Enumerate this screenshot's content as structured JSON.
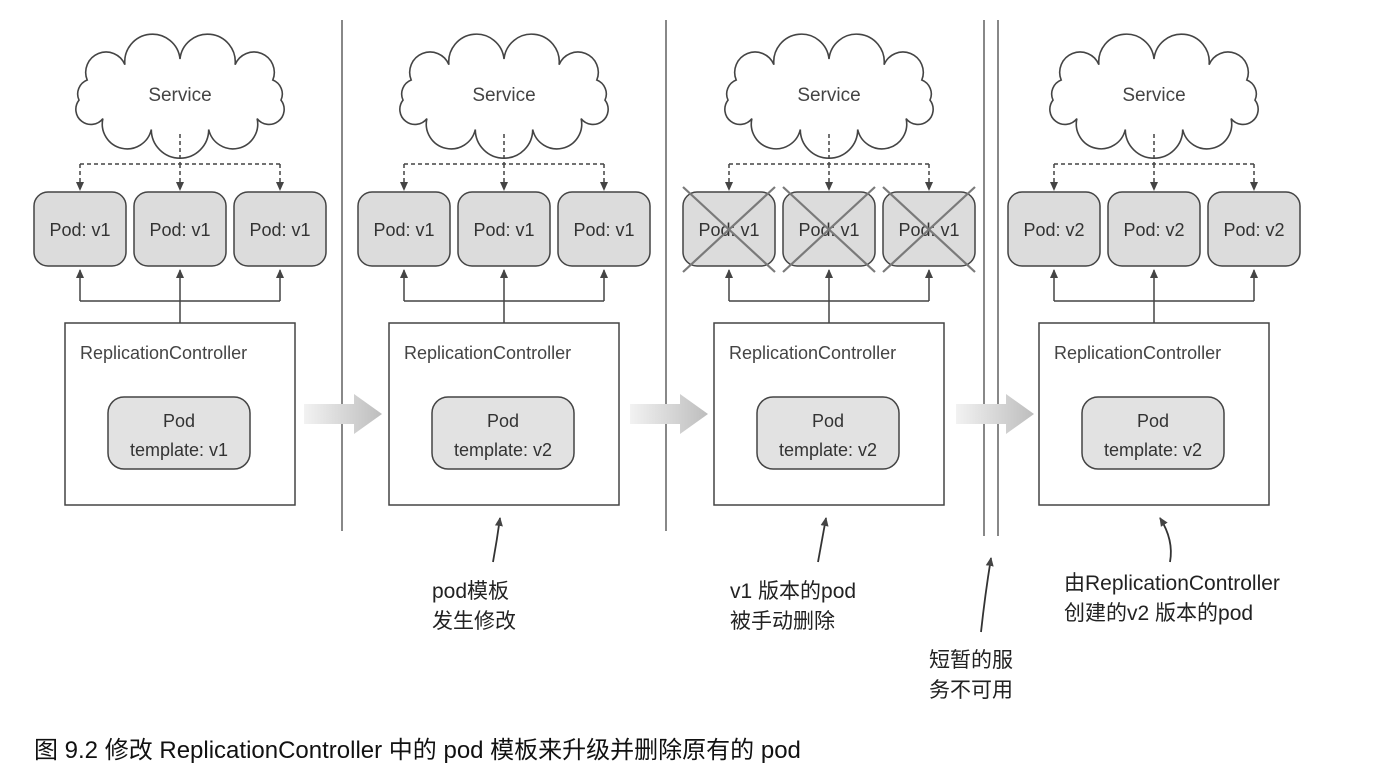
{
  "panels": [
    {
      "service_label": "Service",
      "pods": [
        "Pod: v1",
        "Pod: v1",
        "Pod: v1"
      ],
      "pods_deleted": false,
      "controller_label": "ReplicationController",
      "template_line1": "Pod",
      "template_line2": "template: v1"
    },
    {
      "service_label": "Service",
      "pods": [
        "Pod: v1",
        "Pod: v1",
        "Pod: v1"
      ],
      "pods_deleted": false,
      "controller_label": "ReplicationController",
      "template_line1": "Pod",
      "template_line2": "template: v2"
    },
    {
      "service_label": "Service",
      "pods": [
        "Pod: v1",
        "Pod: v1",
        "Pod: v1"
      ],
      "pods_deleted": true,
      "controller_label": "ReplicationController",
      "template_line1": "Pod",
      "template_line2": "template: v2"
    },
    {
      "service_label": "Service",
      "pods": [
        "Pod: v2",
        "Pod: v2",
        "Pod: v2"
      ],
      "pods_deleted": false,
      "controller_label": "ReplicationController",
      "template_line1": "Pod",
      "template_line2": "template: v2"
    }
  ],
  "notes": {
    "template_changed": [
      "pod模板",
      "发生修改"
    ],
    "v1_deleted": [
      "v1 版本的pod",
      "被手动删除"
    ],
    "unavailable": [
      "短暂的服",
      "务不可用"
    ],
    "v2_created": [
      "由ReplicationController",
      "创建的v2 版本的pod"
    ]
  },
  "caption": "图 9.2   修改 ReplicationController 中的 pod 模板来升级并删除原有的 pod",
  "colors": {
    "pod_fill": "#dcdcdc",
    "template_fill": "#e2e2e2",
    "line": "#444444",
    "cross": "#7a7a7a",
    "transition_arrow": "#cfcfcf"
  }
}
